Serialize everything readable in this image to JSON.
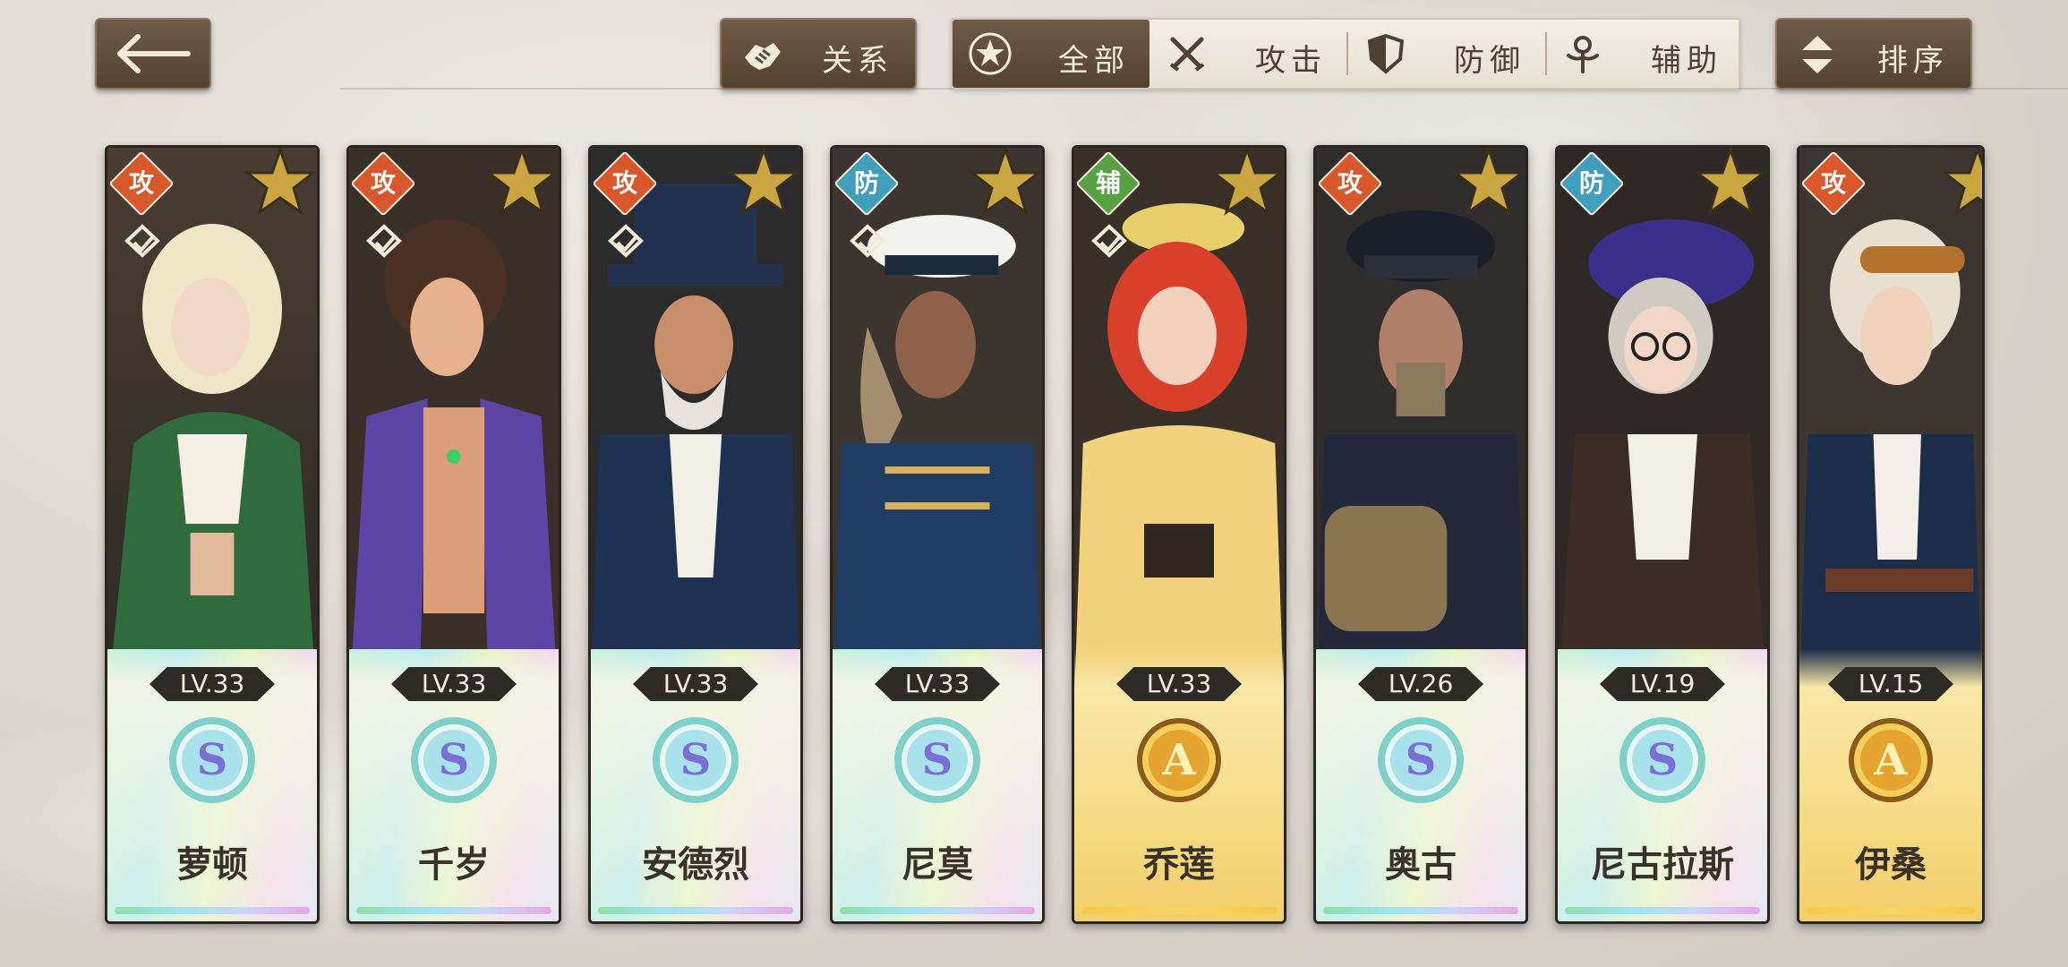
{
  "header": {
    "back_label": "back",
    "relation_label": "关系",
    "sort_label": "排序",
    "filters": [
      {
        "label": "全部",
        "active": true
      },
      {
        "label": "攻击",
        "active": false
      },
      {
        "label": "防御",
        "active": false
      },
      {
        "label": "辅助",
        "active": false
      }
    ]
  },
  "colors": {
    "button_brown": "#5f4d3b",
    "attack_badge": "#d9582b",
    "defense_badge": "#3f9fbd",
    "support_badge": "#56a242"
  },
  "characters": [
    {
      "name": "萝顿",
      "level": "LV.33",
      "role": "攻",
      "rank": "S"
    },
    {
      "name": "千岁",
      "level": "LV.33",
      "role": "攻",
      "rank": "S"
    },
    {
      "name": "安德烈",
      "level": "LV.33",
      "role": "攻",
      "rank": "S"
    },
    {
      "name": "尼莫",
      "level": "LV.33",
      "role": "防",
      "rank": "S"
    },
    {
      "name": "乔莲",
      "level": "LV.33",
      "role": "辅",
      "rank": "A"
    },
    {
      "name": "奥古",
      "level": "LV.26",
      "role": "攻",
      "rank": "S"
    },
    {
      "name": "尼古拉斯",
      "level": "LV.19",
      "role": "防",
      "rank": "S"
    },
    {
      "name": "伊桑",
      "level": "LV.15",
      "role": "攻",
      "rank": "A"
    }
  ]
}
